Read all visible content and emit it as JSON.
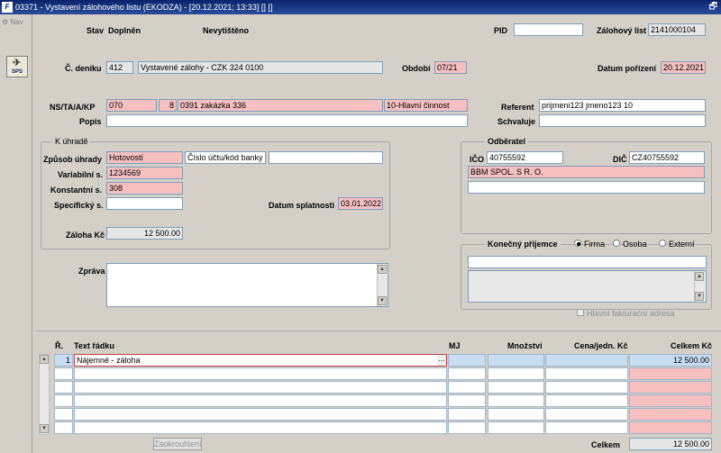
{
  "window": {
    "title": "03371 - Vystavení zálohového listu (EKODZA) - [20.12.2021; 13:33] [] []",
    "restore_glyph": "🗗"
  },
  "nav": {
    "label": "Nav",
    "sps_label": "SPS"
  },
  "header": {
    "stav_label": "Stav",
    "stav_value": "Doplněn",
    "print_status": "Nevytištěno",
    "pid_label": "PID",
    "pid_value": "",
    "zl_label": "Zálohový list",
    "zl_value": "2141000104"
  },
  "denik": {
    "label": "Č. deníku",
    "code": "412",
    "name": "Vystavené zálohy - CZK 324 0100",
    "obdobi_label": "Období",
    "obdobi_value": "07/21",
    "datum_porizeni_label": "Datum pořízení",
    "datum_porizeni_value": "20.12.2021"
  },
  "ns": {
    "label": "NS/TA/A/KP",
    "ns": "070",
    "ta": "8",
    "a": "0391 zakázka 336",
    "kp": "10-Hlavní činnost",
    "referent_label": "Referent",
    "referent_value": "prijmeni123 jmeno123 10",
    "popis_label": "Popis",
    "popis_value": "",
    "schvaluje_label": "Schvaluje",
    "schvaluje_value": ""
  },
  "k_uhrade": {
    "title": "K úhradě",
    "zpusob_label": "Způsob úhrady",
    "zpusob_value": "Hotovostí",
    "ucet_value": "Číslo účtu/kód banky",
    "ucet_extra": "",
    "variabilni_label": "Variabilní s.",
    "variabilni_value": "1234569",
    "konstantni_label": "Konstantní s.",
    "konstantni_value": "308",
    "specificky_label": "Specifický s.",
    "specificky_value": "",
    "splatnost_label": "Datum splatnosti",
    "splatnost_value": "03.01.2022",
    "zaloha_label": "Záloha Kč",
    "zaloha_value": "12 500.00"
  },
  "odberatel": {
    "title": "Odběratel",
    "ico_label": "IČO",
    "ico_value": "40755592",
    "dic_label": "DIČ",
    "dic_value": "CZ40755592",
    "name": "BBM SPOL. S R. O.",
    "line2": ""
  },
  "konecny": {
    "title": "Konečný příjemce",
    "options": [
      "Firma",
      "Osoba",
      "Externí"
    ],
    "selected": "Firma",
    "field_value": "",
    "hlavni_label": "Hlavní fakturační adresa"
  },
  "zprava": {
    "label": "Zpráva",
    "value": ""
  },
  "table": {
    "headers": {
      "r": "Ř.",
      "text": "Text řádku",
      "mj": "MJ",
      "mnozstvi": "Množství",
      "cena": "Cena/jedn. Kč",
      "celkem": "Celkem Kč"
    },
    "rows": [
      {
        "r": "1",
        "text": "Nájemné - záloha",
        "mj": "",
        "mnozstvi": "",
        "cena": "",
        "celkem": "12 500.00"
      },
      {
        "r": "",
        "text": "",
        "mj": "",
        "mnozstvi": "",
        "cena": "",
        "celkem": ""
      },
      {
        "r": "",
        "text": "",
        "mj": "",
        "mnozstvi": "",
        "cena": "",
        "celkem": ""
      },
      {
        "r": "",
        "text": "",
        "mj": "",
        "mnozstvi": "",
        "cena": "",
        "celkem": ""
      },
      {
        "r": "",
        "text": "",
        "mj": "",
        "mnozstvi": "",
        "cena": "",
        "celkem": ""
      },
      {
        "r": "",
        "text": "",
        "mj": "",
        "mnozstvi": "",
        "cena": "",
        "celkem": ""
      }
    ],
    "ellipsis": "...",
    "round_button": "Zaokrouhlení",
    "total_label": "Celkem",
    "total_value": "12 500.00"
  },
  "colors": {
    "title_bar": "#0a246a",
    "required_field": "#f6c0c0",
    "active_row": "#c8dcf2"
  }
}
